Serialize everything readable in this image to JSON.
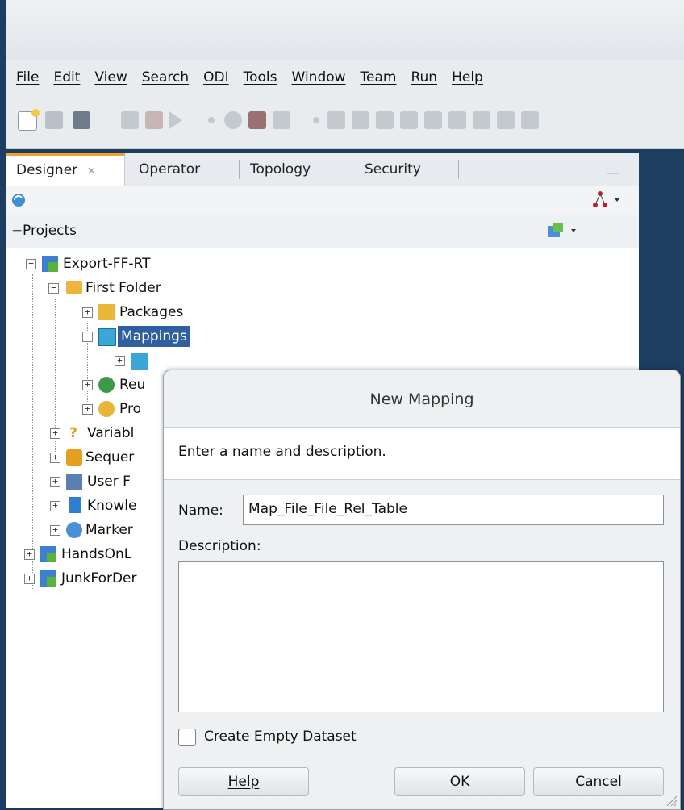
{
  "menubar": {
    "items": [
      "File",
      "Edit",
      "View",
      "Search",
      "ODI",
      "Tools",
      "Window",
      "Team",
      "Run",
      "Help"
    ]
  },
  "navigator": {
    "tabs": [
      "Designer",
      "Operator",
      "Topology",
      "Security"
    ],
    "tab_close_glyph": "×",
    "section_title": "Projects",
    "collapse_glyph": "−"
  },
  "tree": {
    "items": [
      {
        "label": "Export-FF-RT",
        "icon": "project-icon"
      },
      {
        "label": "First Folder",
        "icon": "folder-icon"
      },
      {
        "label": "Packages",
        "icon": "package-icon"
      },
      {
        "label": "Mappings",
        "icon": "mapping-icon"
      },
      {
        "label": "",
        "icon": "mapping-icon"
      },
      {
        "label": "Reu",
        "icon": "reusable-mapping-icon"
      },
      {
        "label": "Pro",
        "icon": "procedure-icon"
      },
      {
        "label": "Variabl",
        "icon": "variable-icon"
      },
      {
        "label": "Sequer",
        "icon": "sequence-icon"
      },
      {
        "label": "User F",
        "icon": "user-function-icon"
      },
      {
        "label": "Knowle",
        "icon": "knowledge-module-icon"
      },
      {
        "label": "Marker",
        "icon": "marker-icon"
      },
      {
        "label": "HandsOnL",
        "icon": "project-icon"
      },
      {
        "label": "JunkForDer",
        "icon": "project-icon"
      }
    ]
  },
  "dialog": {
    "title": "New Mapping",
    "instruction": "Enter a name and description.",
    "name_label": "Name:",
    "name_value": "Map_File_File_Rel_Table",
    "description_label": "Description:",
    "description_value": "",
    "checkbox_label": "Create Empty Dataset",
    "checkbox_checked": false,
    "help_label": "Help",
    "ok_label": "OK",
    "cancel_label": "Cancel"
  },
  "colors": {
    "frame": "#1d3e60",
    "selection": "#2f5f9e",
    "tab_accent": "#f0a030"
  }
}
